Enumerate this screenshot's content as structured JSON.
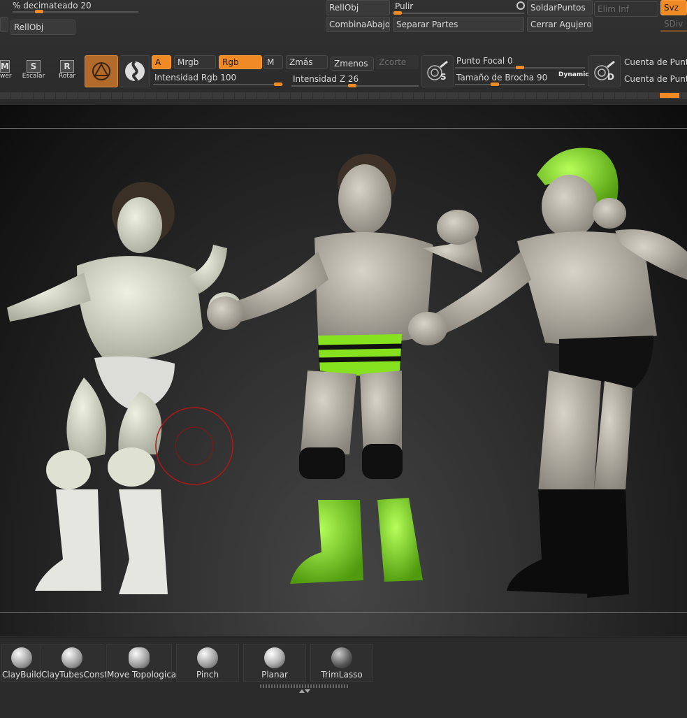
{
  "top_left": {
    "decimate_label": "% decimateado",
    "decimate_value": "20",
    "rellobj_label": "RellObj"
  },
  "top_center": {
    "rellobj": "RellObj",
    "pulir": "Pulir",
    "combina": "CombinaAbajo",
    "separar": "Separar Partes"
  },
  "top_right": {
    "soldar": "SoldarPuntos",
    "elim_inf": "Elim Inf",
    "svz": "Svz",
    "cerrar": "Cerrar Agujeros",
    "sdiv": "SDiv"
  },
  "toolbar": {
    "move_key": "M",
    "move_label": "wer",
    "scale_key": "S",
    "scale_label": "Escalar",
    "rotate_key": "R",
    "rotate_label": "Rotar",
    "a": "A",
    "mrgb": "Mrgb",
    "rgb": "Rgb",
    "m": "M",
    "zmas": "Zmás",
    "zmenos": "Zmenos",
    "zcorte": "Zcorte",
    "intensidad_rgb_label": "Intensidad Rgb",
    "intensidad_rgb_value": "100",
    "intensidad_z_label": "Intensidad Z",
    "intensidad_z_value": "26",
    "punto_focal_label": "Punto Focal",
    "punto_focal_value": "0",
    "tamano_label": "Tamaño de Brocha",
    "tamano_value": "90",
    "dynamic": "Dynamic",
    "cuenta_1": "Cuenta de Punto",
    "cuenta_2": "Cuenta de Punto",
    "s_icon_letter": "S",
    "d_icon_letter": "D"
  },
  "brushes": [
    {
      "label": "ClayBuildup"
    },
    {
      "label": "ClayTubesConsta"
    },
    {
      "label": "Move Topologica"
    },
    {
      "label": "Pinch"
    },
    {
      "label": "Planar"
    },
    {
      "label": "TrimLasso"
    }
  ],
  "colors": {
    "accent": "#f08a24",
    "figure_green": "#86e21e",
    "figure_skin": "#bdb7ad",
    "figure_pale": "#d9dccb",
    "trunks_black": "#111111",
    "cursor_red": "#b01818"
  }
}
